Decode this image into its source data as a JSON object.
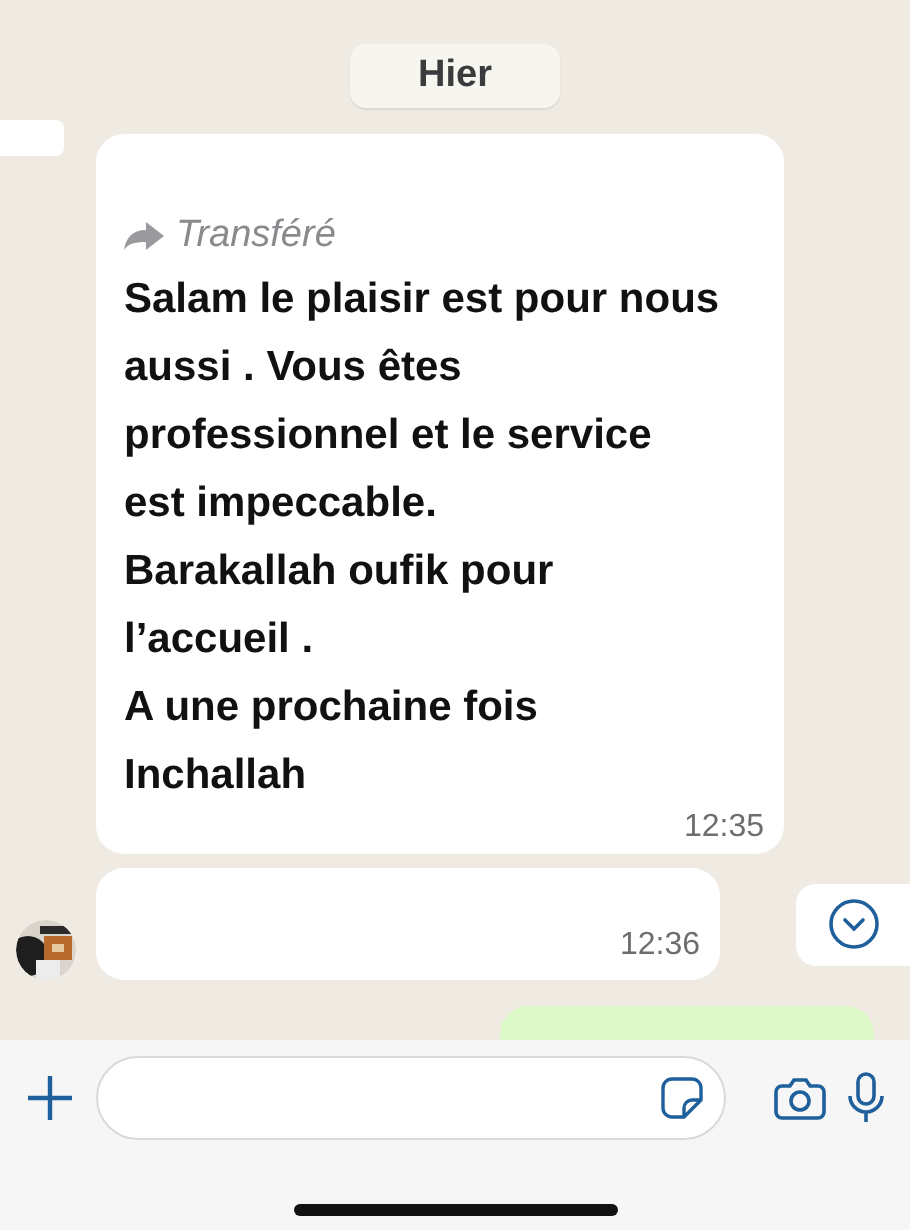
{
  "date_chip": "Hier",
  "messages": [
    {
      "kind": "incoming",
      "forwarded_label": "Transféré",
      "text": "Salam le plaisir est pour nous\naussi . Vous êtes\nprofessionnel et le service\nest impeccable.\nBarakallah oufik pour\nl’accueil .\nA une prochaine fois\nInchallah",
      "time": "12:35"
    },
    {
      "kind": "incoming",
      "time": "12:36"
    },
    {
      "kind": "outgoing"
    }
  ]
}
